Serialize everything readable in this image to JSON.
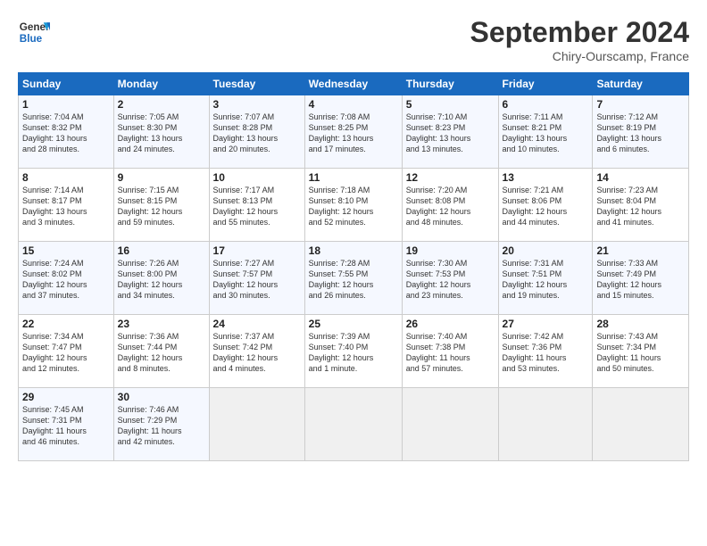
{
  "header": {
    "logo_line1": "General",
    "logo_line2": "Blue",
    "month": "September 2024",
    "location": "Chiry-Ourscamp, France"
  },
  "weekdays": [
    "Sunday",
    "Monday",
    "Tuesday",
    "Wednesday",
    "Thursday",
    "Friday",
    "Saturday"
  ],
  "weeks": [
    [
      {
        "day": "1",
        "info": "Sunrise: 7:04 AM\nSunset: 8:32 PM\nDaylight: 13 hours\nand 28 minutes."
      },
      {
        "day": "2",
        "info": "Sunrise: 7:05 AM\nSunset: 8:30 PM\nDaylight: 13 hours\nand 24 minutes."
      },
      {
        "day": "3",
        "info": "Sunrise: 7:07 AM\nSunset: 8:28 PM\nDaylight: 13 hours\nand 20 minutes."
      },
      {
        "day": "4",
        "info": "Sunrise: 7:08 AM\nSunset: 8:25 PM\nDaylight: 13 hours\nand 17 minutes."
      },
      {
        "day": "5",
        "info": "Sunrise: 7:10 AM\nSunset: 8:23 PM\nDaylight: 13 hours\nand 13 minutes."
      },
      {
        "day": "6",
        "info": "Sunrise: 7:11 AM\nSunset: 8:21 PM\nDaylight: 13 hours\nand 10 minutes."
      },
      {
        "day": "7",
        "info": "Sunrise: 7:12 AM\nSunset: 8:19 PM\nDaylight: 13 hours\nand 6 minutes."
      }
    ],
    [
      {
        "day": "8",
        "info": "Sunrise: 7:14 AM\nSunset: 8:17 PM\nDaylight: 13 hours\nand 3 minutes."
      },
      {
        "day": "9",
        "info": "Sunrise: 7:15 AM\nSunset: 8:15 PM\nDaylight: 12 hours\nand 59 minutes."
      },
      {
        "day": "10",
        "info": "Sunrise: 7:17 AM\nSunset: 8:13 PM\nDaylight: 12 hours\nand 55 minutes."
      },
      {
        "day": "11",
        "info": "Sunrise: 7:18 AM\nSunset: 8:10 PM\nDaylight: 12 hours\nand 52 minutes."
      },
      {
        "day": "12",
        "info": "Sunrise: 7:20 AM\nSunset: 8:08 PM\nDaylight: 12 hours\nand 48 minutes."
      },
      {
        "day": "13",
        "info": "Sunrise: 7:21 AM\nSunset: 8:06 PM\nDaylight: 12 hours\nand 44 minutes."
      },
      {
        "day": "14",
        "info": "Sunrise: 7:23 AM\nSunset: 8:04 PM\nDaylight: 12 hours\nand 41 minutes."
      }
    ],
    [
      {
        "day": "15",
        "info": "Sunrise: 7:24 AM\nSunset: 8:02 PM\nDaylight: 12 hours\nand 37 minutes."
      },
      {
        "day": "16",
        "info": "Sunrise: 7:26 AM\nSunset: 8:00 PM\nDaylight: 12 hours\nand 34 minutes."
      },
      {
        "day": "17",
        "info": "Sunrise: 7:27 AM\nSunset: 7:57 PM\nDaylight: 12 hours\nand 30 minutes."
      },
      {
        "day": "18",
        "info": "Sunrise: 7:28 AM\nSunset: 7:55 PM\nDaylight: 12 hours\nand 26 minutes."
      },
      {
        "day": "19",
        "info": "Sunrise: 7:30 AM\nSunset: 7:53 PM\nDaylight: 12 hours\nand 23 minutes."
      },
      {
        "day": "20",
        "info": "Sunrise: 7:31 AM\nSunset: 7:51 PM\nDaylight: 12 hours\nand 19 minutes."
      },
      {
        "day": "21",
        "info": "Sunrise: 7:33 AM\nSunset: 7:49 PM\nDaylight: 12 hours\nand 15 minutes."
      }
    ],
    [
      {
        "day": "22",
        "info": "Sunrise: 7:34 AM\nSunset: 7:47 PM\nDaylight: 12 hours\nand 12 minutes."
      },
      {
        "day": "23",
        "info": "Sunrise: 7:36 AM\nSunset: 7:44 PM\nDaylight: 12 hours\nand 8 minutes."
      },
      {
        "day": "24",
        "info": "Sunrise: 7:37 AM\nSunset: 7:42 PM\nDaylight: 12 hours\nand 4 minutes."
      },
      {
        "day": "25",
        "info": "Sunrise: 7:39 AM\nSunset: 7:40 PM\nDaylight: 12 hours\nand 1 minute."
      },
      {
        "day": "26",
        "info": "Sunrise: 7:40 AM\nSunset: 7:38 PM\nDaylight: 11 hours\nand 57 minutes."
      },
      {
        "day": "27",
        "info": "Sunrise: 7:42 AM\nSunset: 7:36 PM\nDaylight: 11 hours\nand 53 minutes."
      },
      {
        "day": "28",
        "info": "Sunrise: 7:43 AM\nSunset: 7:34 PM\nDaylight: 11 hours\nand 50 minutes."
      }
    ],
    [
      {
        "day": "29",
        "info": "Sunrise: 7:45 AM\nSunset: 7:31 PM\nDaylight: 11 hours\nand 46 minutes."
      },
      {
        "day": "30",
        "info": "Sunrise: 7:46 AM\nSunset: 7:29 PM\nDaylight: 11 hours\nand 42 minutes."
      },
      {
        "day": "",
        "info": ""
      },
      {
        "day": "",
        "info": ""
      },
      {
        "day": "",
        "info": ""
      },
      {
        "day": "",
        "info": ""
      },
      {
        "day": "",
        "info": ""
      }
    ]
  ]
}
